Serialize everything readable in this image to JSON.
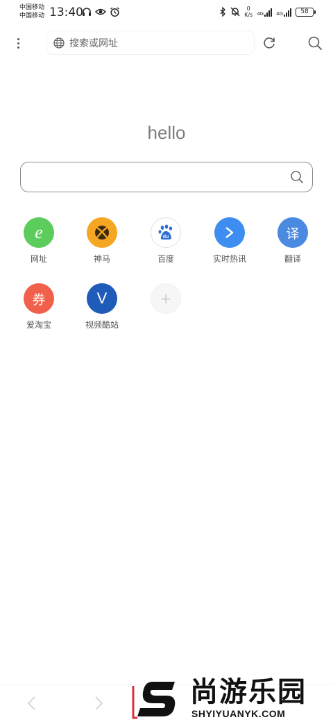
{
  "status_bar": {
    "carrier_1": "中国移动",
    "carrier_2": "中国移动",
    "time": "13:40",
    "net_speed_value": "0",
    "net_speed_unit": "K/s",
    "signal_1": "4G",
    "signal_2": "4G",
    "battery": "58",
    "icons_left": [
      "headphones-icon",
      "eye-icon",
      "alarm-icon"
    ],
    "icons_right": [
      "bluetooth-icon",
      "mute-bell-icon"
    ]
  },
  "toolbar": {
    "address_placeholder": "搜索或网址",
    "icons": [
      "more-vertical-icon",
      "globe-icon",
      "reload-icon",
      "search-icon"
    ]
  },
  "home": {
    "greeting": "hello",
    "search_placeholder": ""
  },
  "shortcuts": [
    {
      "label": "网址",
      "glyph": "e",
      "color": "#5ccc5c"
    },
    {
      "label": "神马",
      "glyph": "",
      "color": "#f5a623"
    },
    {
      "label": "百度",
      "glyph": "",
      "color": "#ffffff"
    },
    {
      "label": "实时热讯",
      "glyph": "",
      "color": "#3d8ef0"
    },
    {
      "label": "翻译",
      "glyph": "译",
      "color": "#4a8ae0"
    },
    {
      "label": "爱淘宝",
      "glyph": "券",
      "color": "#f0604a"
    },
    {
      "label": "视频酷站",
      "glyph": "V",
      "color": "#1f5bb8"
    }
  ],
  "add_shortcut": {
    "glyph": "+"
  },
  "watermark": {
    "brand": "尚游乐园",
    "url": "SHYIYUANYK.COM",
    "accent": "#d6333f"
  }
}
